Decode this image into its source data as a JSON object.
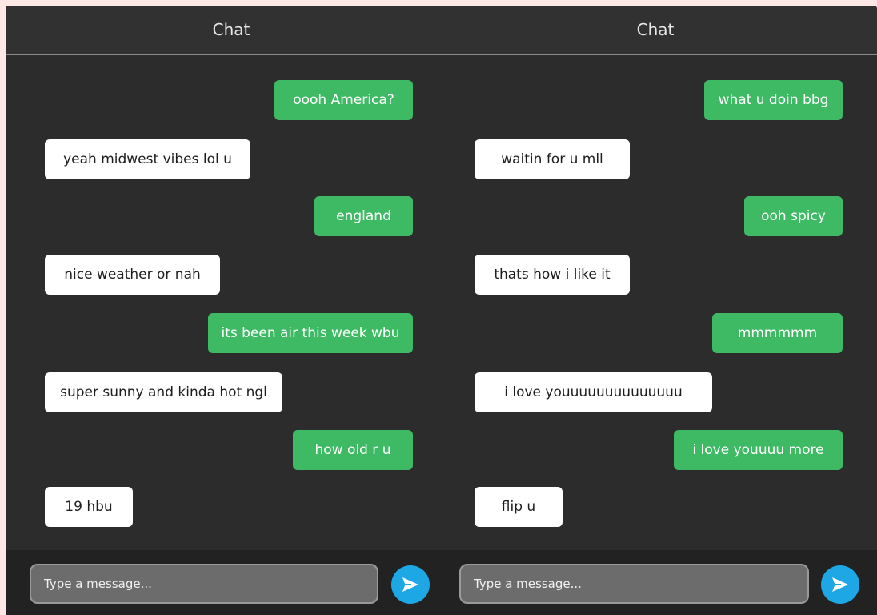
{
  "panels": [
    {
      "title": "Chat",
      "messages": [
        {
          "side": "sent",
          "text": "oooh America?"
        },
        {
          "side": "recv",
          "text": "yeah midwest vibes lol u"
        },
        {
          "side": "sent",
          "text": "england"
        },
        {
          "side": "recv",
          "text": "nice weather or nah"
        },
        {
          "side": "sent",
          "text": "its been air this week wbu"
        },
        {
          "side": "recv",
          "text": "super sunny and kinda hot ngl"
        },
        {
          "side": "sent",
          "text": "how old r u"
        },
        {
          "side": "recv",
          "text": "19 hbu"
        }
      ],
      "input_placeholder": "Type a message...",
      "send_icon": "send-arrow-icon"
    },
    {
      "title": "Chat",
      "messages": [
        {
          "side": "sent",
          "text": "what u doin bbg"
        },
        {
          "side": "recv",
          "text": "waitin for u mll"
        },
        {
          "side": "sent",
          "text": "ooh spicy"
        },
        {
          "side": "recv",
          "text": "thats how i like it"
        },
        {
          "side": "sent",
          "text": "mmmmmm"
        },
        {
          "side": "recv",
          "text": "i love youuuuuuuuuuuuuu"
        },
        {
          "side": "sent",
          "text": "i love youuuu more"
        },
        {
          "side": "recv",
          "text": "flip u"
        }
      ],
      "input_placeholder": "Type a message...",
      "send_icon": "send-arrow-icon"
    }
  ],
  "colors": {
    "sent_bubble": "#3dba63",
    "recv_bubble": "#ffffff",
    "send_button": "#1ea7e5",
    "background": "#2c2c2c"
  }
}
